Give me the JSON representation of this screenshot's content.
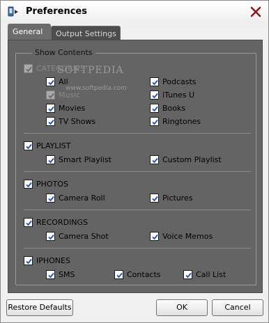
{
  "window": {
    "title": "Preferences",
    "app_icon": "device-sync-icon",
    "close_icon": "close-x-icon",
    "accent_close_color": "#8b1a1a"
  },
  "tabs": [
    {
      "label": "General",
      "selected": true
    },
    {
      "label": "Output Settings",
      "selected": false
    }
  ],
  "watermark": {
    "text": "SOFTPEDIA",
    "url": "www.softpedia.com"
  },
  "show_contents": {
    "legend": "Show Contents",
    "categories": {
      "label": "CATEGORIES",
      "checked": true,
      "disabled": true,
      "items": [
        {
          "label": "All",
          "checked": true,
          "disabled": false
        },
        {
          "label": "Podcasts",
          "checked": true,
          "disabled": false
        },
        {
          "label": "Music",
          "checked": true,
          "disabled": true
        },
        {
          "label": "iTunes U",
          "checked": true,
          "disabled": false
        },
        {
          "label": "Movies",
          "checked": true,
          "disabled": false
        },
        {
          "label": "Books",
          "checked": true,
          "disabled": false
        },
        {
          "label": "TV Shows",
          "checked": true,
          "disabled": false
        },
        {
          "label": "Ringtones",
          "checked": true,
          "disabled": false
        }
      ]
    },
    "playlist": {
      "label": "PLAYLIST",
      "checked": true,
      "items": [
        {
          "label": "Smart Playlist",
          "checked": true
        },
        {
          "label": "Custom Playlist",
          "checked": true
        }
      ]
    },
    "photos": {
      "label": "PHOTOS",
      "checked": true,
      "items": [
        {
          "label": "Camera Roll",
          "checked": true
        },
        {
          "label": "Pictures",
          "checked": true
        }
      ]
    },
    "recordings": {
      "label": "RECORDINGS",
      "checked": true,
      "items": [
        {
          "label": "Camera Shot",
          "checked": true
        },
        {
          "label": "Voice Memos",
          "checked": true
        }
      ]
    },
    "iphones": {
      "label": "IPHONES",
      "checked": true,
      "items": [
        {
          "label": "SMS",
          "checked": true
        },
        {
          "label": "Contacts",
          "checked": true
        },
        {
          "label": "Call List",
          "checked": true
        }
      ]
    }
  },
  "buttons": {
    "restore_label": "Restore Defaults",
    "ok_label": "OK",
    "cancel_label": "Cancel"
  }
}
